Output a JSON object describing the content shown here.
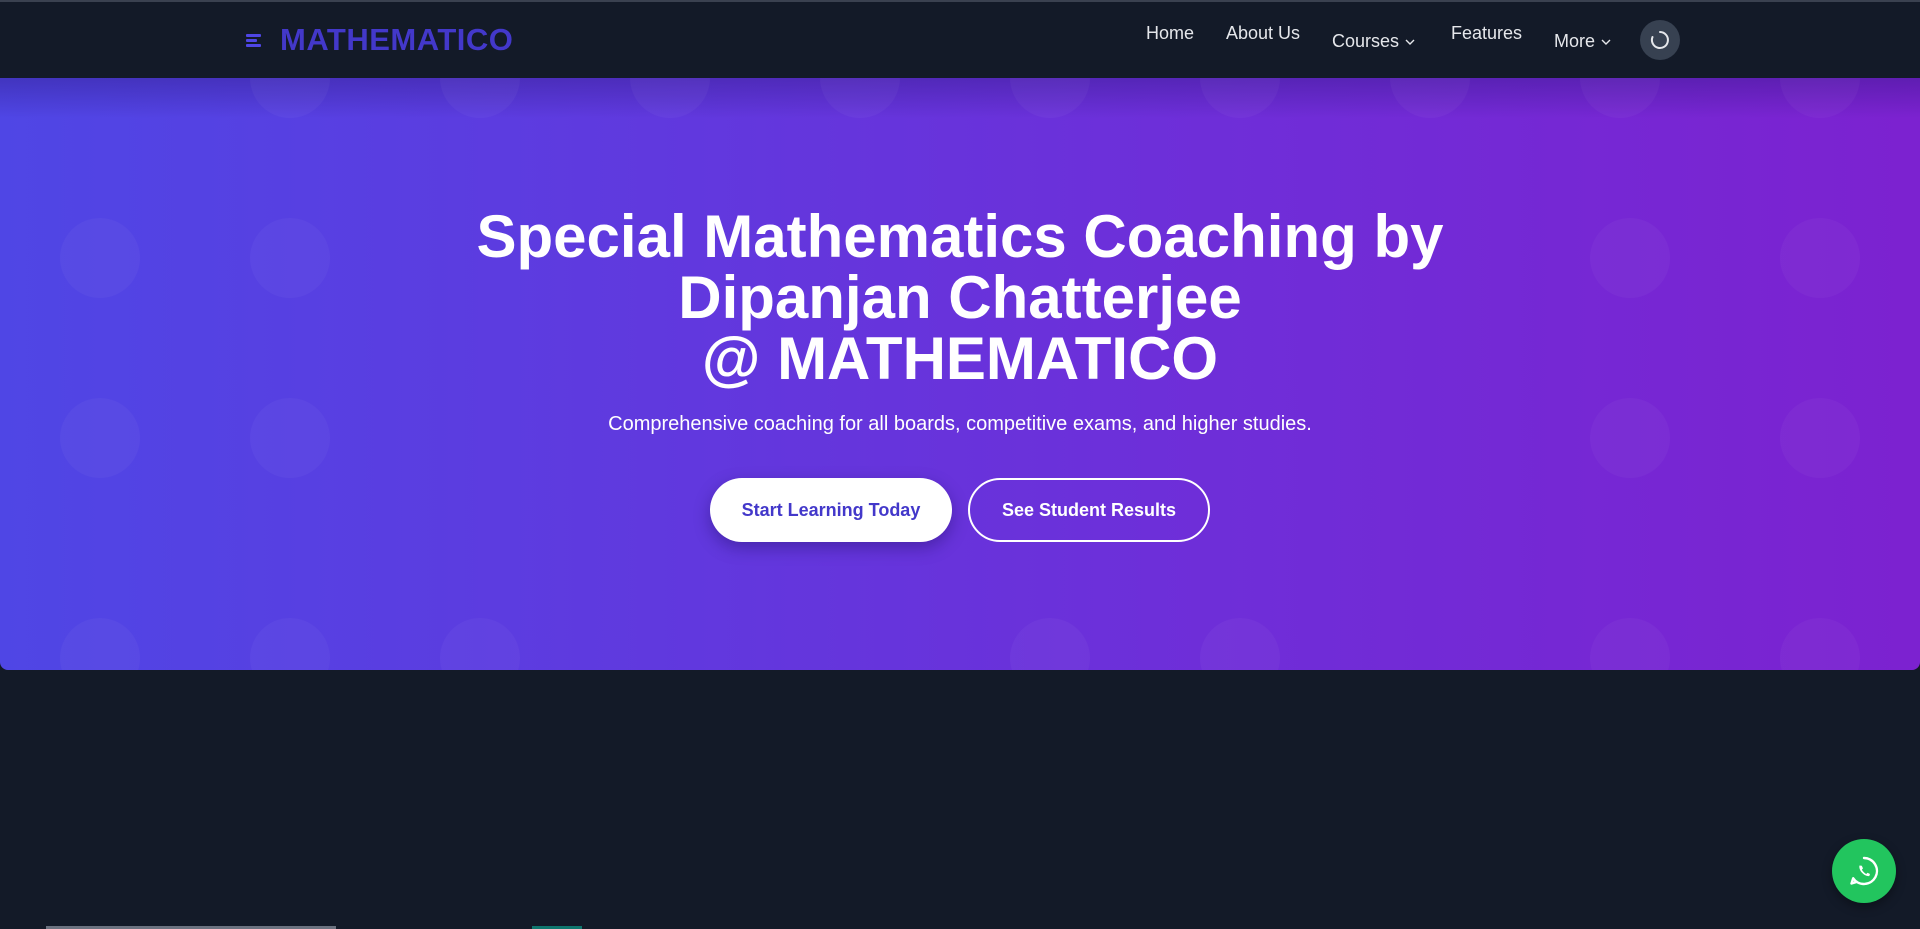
{
  "brand": {
    "name": "MATHEMATICO",
    "icon": "menu-lines-icon"
  },
  "nav": {
    "home": "Home",
    "about": "About Us",
    "courses": "Courses",
    "features": "Features",
    "more": "More",
    "theme_icon": "spinner-icon"
  },
  "hero": {
    "title_line1": "Special Mathematics Coaching by",
    "title_line2": "Dipanjan Chatterjee",
    "title_line3": "@ MATHEMATICO",
    "subtitle": "Comprehensive coaching for all boards, competitive exams, and higher studies.",
    "cta_primary": "Start Learning Today",
    "cta_secondary": "See Student Results"
  },
  "colors": {
    "accent": "#4338ca",
    "gradient_start": "#4f46e5",
    "gradient_end": "#7c22d0",
    "background": "#131a28",
    "whatsapp": "#22c55e"
  },
  "floating": {
    "icon": "whatsapp-icon"
  }
}
